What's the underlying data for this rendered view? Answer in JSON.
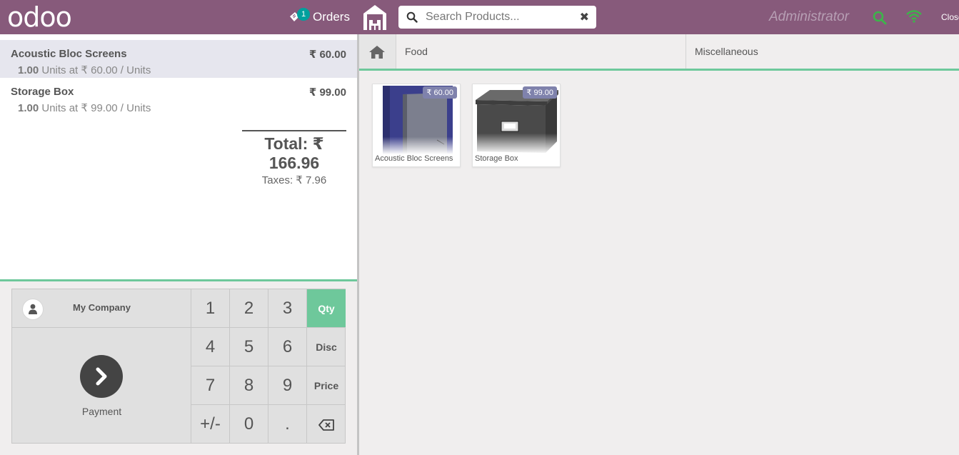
{
  "header": {
    "logo": "odoo",
    "orders_label": "Orders",
    "orders_count": "1",
    "search_placeholder": "Search Products...",
    "clear_glyph": "✖",
    "username": "Administrator",
    "close_label": "Close"
  },
  "order": {
    "lines": [
      {
        "name": "Acoustic Bloc Screens",
        "price": "₹ 60.00",
        "qty": "1.00",
        "info": " Units at ₹ 60.00 / Units",
        "selected": true
      },
      {
        "name": "Storage Box",
        "price": "₹ 99.00",
        "qty": "1.00",
        "info": " Units at ₹ 99.00 / Units",
        "selected": false
      }
    ],
    "total": "Total: ₹ 166.96",
    "taxes": "Taxes: ₹ 7.96"
  },
  "pad": {
    "customer": "My Company",
    "payment": "Payment",
    "keys": [
      "1",
      "2",
      "3",
      "4",
      "5",
      "6",
      "7",
      "8",
      "9",
      "+/-",
      "0",
      "."
    ],
    "modes": [
      "Qty",
      "Disc",
      "Price"
    ],
    "active_mode": "Qty"
  },
  "categories": [
    "Food",
    "Miscellaneous"
  ],
  "products": [
    {
      "name": "Acoustic Bloc Screens",
      "price": "₹ 60.00"
    },
    {
      "name": "Storage Box",
      "price": "₹ 99.00"
    }
  ],
  "colors": {
    "brand": "#875a7b",
    "accent": "#6ec89b",
    "badge": "#00a09d",
    "price_tag": "#7f82ac",
    "status_green": "#3cb54a"
  },
  "icons": [
    "ticket-icon",
    "warehouse-icon",
    "search-icon",
    "close-icon",
    "wifi-icon",
    "user-icon",
    "chevron-right-icon",
    "home-icon",
    "backspace-icon"
  ]
}
